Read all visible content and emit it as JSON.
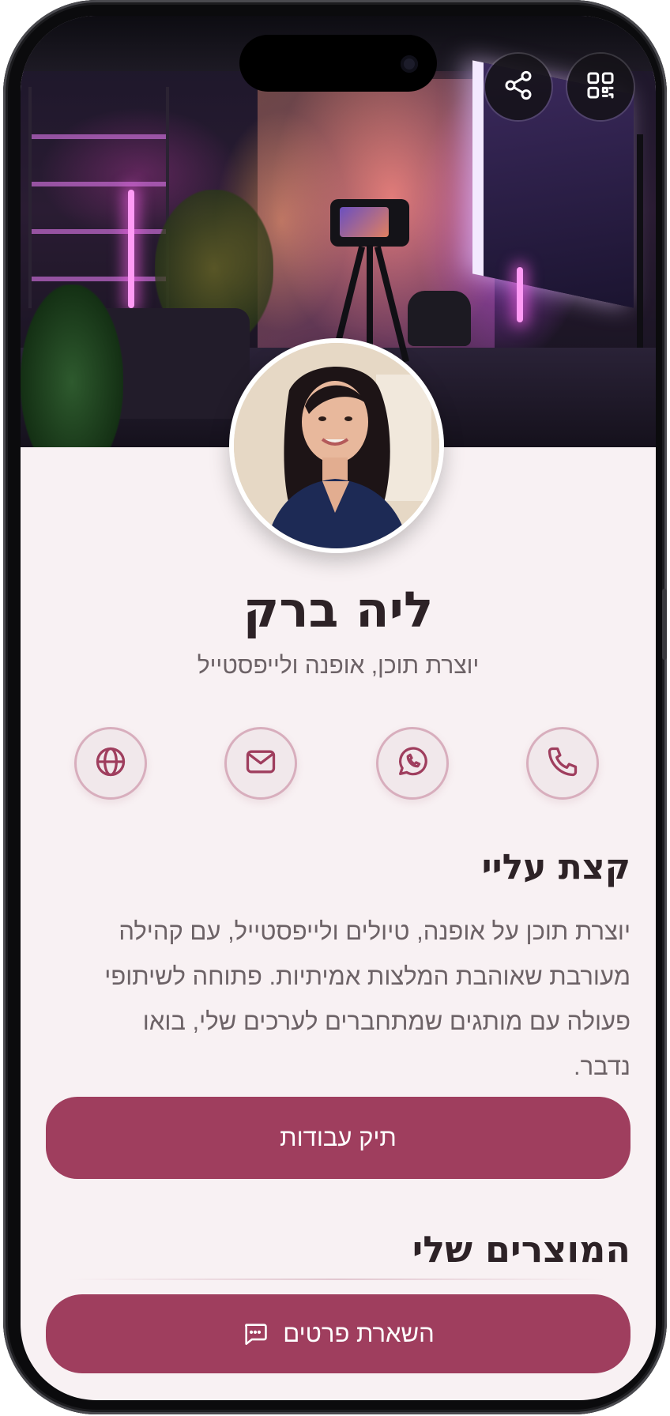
{
  "profile": {
    "name": "ליה ברק",
    "subtitle": "יוצרת תוכן, אופנה ולייפסטייל"
  },
  "header_actions": [
    {
      "icon": "share-icon"
    },
    {
      "icon": "qr-code-icon"
    }
  ],
  "contacts": [
    {
      "icon": "phone-icon"
    },
    {
      "icon": "whatsapp-icon"
    },
    {
      "icon": "mail-icon"
    },
    {
      "icon": "globe-icon"
    }
  ],
  "about": {
    "title": "קצת עליי",
    "text": "יוצרת תוכן על אופנה, טיולים ולייפסטייל, עם קהילה מעורבת שאוהבת המלצות אמיתיות. פתוחה לשיתופי פעולה עם מותגים שמתחברים לערכים שלי, בואו נדבר."
  },
  "portfolio_button": "תיק עבודות",
  "products": {
    "title": "המוצרים שלי"
  },
  "leave_details_button": {
    "label": "השארת פרטים",
    "icon": "chat-bubble-icon"
  },
  "colors": {
    "accent": "#9f3e5e",
    "background": "#f8f1f3",
    "text_dark": "#2d2226",
    "text_muted": "#6c6266",
    "icon_tint": "#9f3e5e"
  }
}
